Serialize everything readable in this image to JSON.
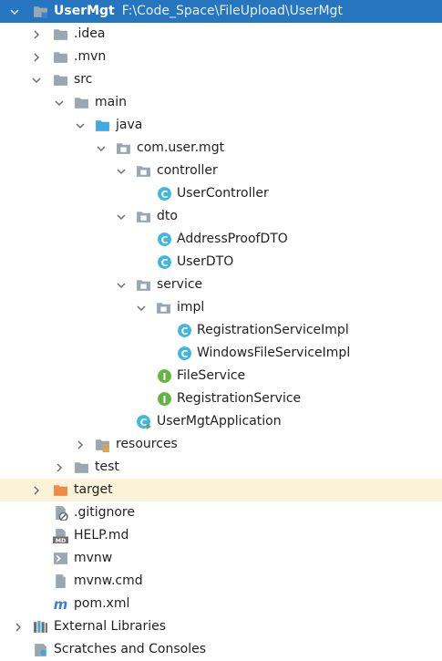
{
  "tree": {
    "root": {
      "name": "UserMgt",
      "path": "F:\\Code_Space\\FileUpload\\UserMgt"
    },
    "nodes": {
      "idea": ".idea",
      "mvn": ".mvn",
      "src": "src",
      "main": "main",
      "java": "java",
      "package": "com.user.mgt",
      "controller": "controller",
      "user_controller": "UserController",
      "dto": "dto",
      "address_proof_dto": "AddressProofDTO",
      "user_dto": "UserDTO",
      "service": "service",
      "impl": "impl",
      "registration_service_impl": "RegistrationServiceImpl",
      "windows_file_service_impl": "WindowsFileServiceImpl",
      "file_service": "FileService",
      "registration_service": "RegistrationService",
      "app": "UserMgtApplication",
      "resources": "resources",
      "test": "test",
      "target": "target",
      "gitignore": ".gitignore",
      "help": "HELP.md",
      "mvnw": "mvnw",
      "mvnw_cmd": "mvnw.cmd",
      "pom": "pom.xml",
      "external_libraries": "External Libraries",
      "scratches": "Scratches and Consoles"
    }
  },
  "icons": {
    "md_badge": "MD",
    "interface_letter": "I",
    "class_letter": "C"
  },
  "colors": {
    "selection": "#2675bf",
    "target_row": "#fbf3d9",
    "folder": "#9aa7b0",
    "source_folder": "#40a9e0",
    "excluded_folder": "#f08a45",
    "class_icon": "#40b6e0",
    "interface_icon": "#62b543"
  }
}
